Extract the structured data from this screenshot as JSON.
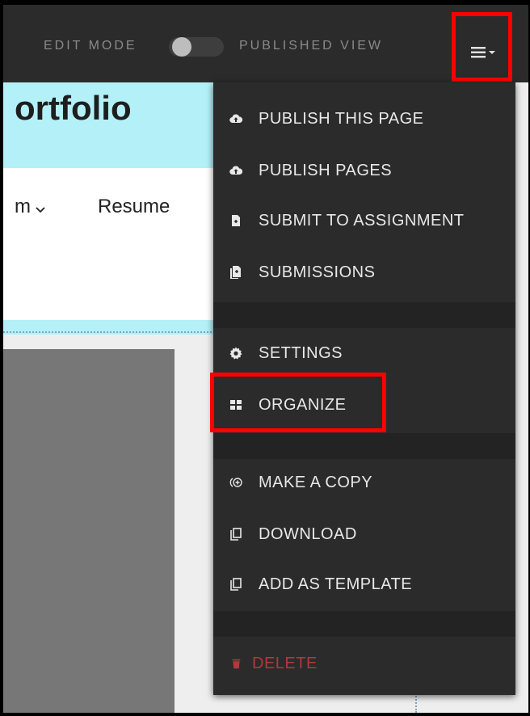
{
  "toolbar": {
    "edit_mode_label": "EDIT MODE",
    "published_view_label": "PUBLISHED VIEW",
    "toggle_on": false
  },
  "page": {
    "title": "ortfolio",
    "nav": [
      {
        "label": "m"
      },
      {
        "label": "Resume"
      }
    ]
  },
  "menu": {
    "items": [
      {
        "label": "PUBLISH THIS PAGE",
        "icon": "cloud-upload-icon"
      },
      {
        "label": "PUBLISH PAGES",
        "icon": "cloud-upload-icon"
      },
      {
        "label": "SUBMIT TO ASSIGNMENT",
        "icon": "file-submit-icon"
      },
      {
        "label": "SUBMISSIONS",
        "icon": "files-icon"
      },
      {
        "label": "SETTINGS",
        "icon": "gear-icon"
      },
      {
        "label": "ORGANIZE",
        "icon": "grid-icon"
      },
      {
        "label": "MAKE A COPY",
        "icon": "copy-add-icon"
      },
      {
        "label": "DOWNLOAD",
        "icon": "copy-icon"
      },
      {
        "label": "ADD AS TEMPLATE",
        "icon": "copy-icon"
      },
      {
        "label": "DELETE",
        "icon": "trash-icon"
      }
    ]
  },
  "colors": {
    "toolbar_bg": "#2b2b2b",
    "highlight": "#ff0000",
    "accent_band": "#b4f0f7",
    "danger": "#b0393d"
  }
}
